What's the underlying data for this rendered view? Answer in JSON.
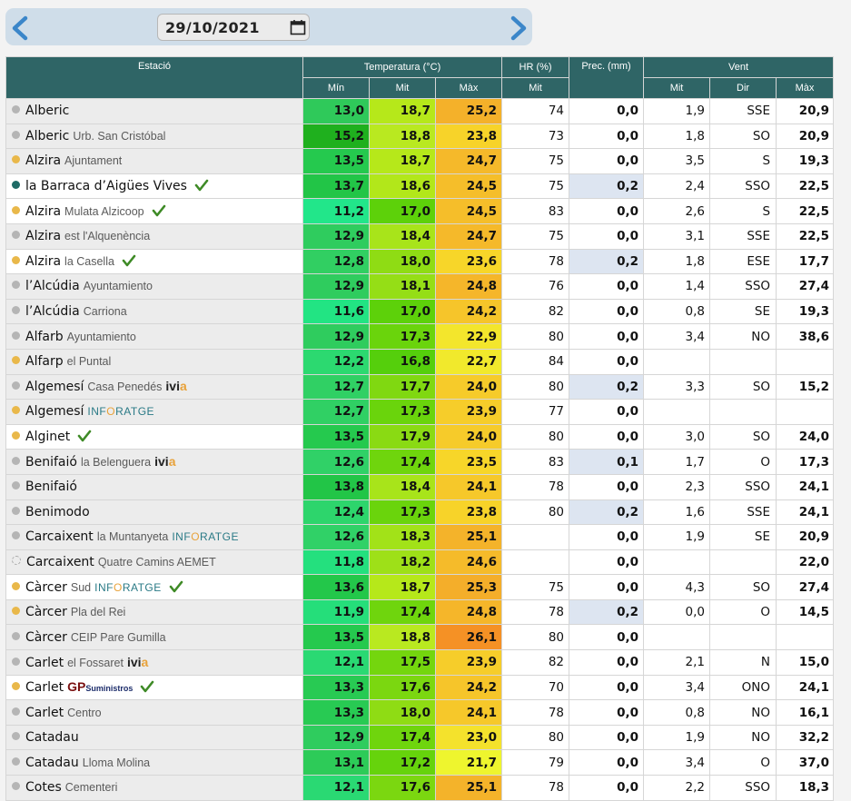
{
  "toolbar": {
    "date": "29/10/2021"
  },
  "headers": {
    "estacio": "Estació",
    "temperatura": "Temperatura (°C)",
    "hr": "HR (%)",
    "prec": "Prec. (mm)",
    "vent": "Vent",
    "min": "Mín",
    "mit": "Mit",
    "max": "Màx",
    "hr_mit": "Mit",
    "vent_mit": "Mit",
    "dir": "Dir",
    "vent_max": "Màx"
  },
  "colors": {
    "header_bg": "#2f6566",
    "dot_gray": "#b5b5b5",
    "dot_orange": "#e9b84a",
    "dot_teal": "#1f6b66",
    "precip_highlight": "#dde5f1",
    "check": "#3e8a26"
  },
  "rows": [
    {
      "name": "Alberic",
      "sub": "",
      "brand": "",
      "dot": "gray",
      "check": false,
      "active": false,
      "tmin": "13,0",
      "tmit": "18,7",
      "tmax": "25,2",
      "cmin": "#2fc95a",
      "cmit": "#b6e81a",
      "cmax": "#f4b12a",
      "hr": "74",
      "prec": "0,0",
      "prec_hl": false,
      "vmit": "1,9",
      "dir": "SSE",
      "vmax": "20,9"
    },
    {
      "name": "Alberic",
      "sub": "Urb. San Cristóbal",
      "brand": "",
      "dot": "gray",
      "check": false,
      "active": false,
      "tmin": "15,2",
      "tmit": "18,8",
      "tmax": "23,8",
      "cmin": "#1fb01e",
      "cmit": "#b9e920",
      "cmax": "#f7d329",
      "hr": "73",
      "prec": "0,0",
      "prec_hl": false,
      "vmit": "1,8",
      "dir": "SO",
      "vmax": "20,9"
    },
    {
      "name": "Alzira",
      "sub": "Ajuntament",
      "brand": "",
      "dot": "orange",
      "check": false,
      "active": false,
      "tmin": "13,5",
      "tmit": "18,7",
      "tmax": "24,7",
      "cmin": "#25c94e",
      "cmit": "#b6e81a",
      "cmax": "#f5b92a",
      "hr": "75",
      "prec": "0,0",
      "prec_hl": false,
      "vmit": "3,5",
      "dir": "S",
      "vmax": "19,3"
    },
    {
      "name": "la Barraca d’Aigües Vives",
      "sub": "",
      "brand": "",
      "dot": "teal",
      "check": true,
      "active": true,
      "tmin": "13,7",
      "tmit": "18,6",
      "tmax": "24,5",
      "cmin": "#22c547",
      "cmit": "#b2e71a",
      "cmax": "#f5be2a",
      "hr": "75",
      "prec": "0,2",
      "prec_hl": true,
      "vmit": "2,4",
      "dir": "SSO",
      "vmax": "22,5"
    },
    {
      "name": "Alzira",
      "sub": "Mulata Alzicoop",
      "brand": "",
      "dot": "orange",
      "check": true,
      "active": true,
      "tmin": "11,2",
      "tmit": "17,0",
      "tmax": "24,5",
      "cmin": "#22e68a",
      "cmit": "#5dd10a",
      "cmax": "#f5be2a",
      "hr": "83",
      "prec": "0,0",
      "prec_hl": false,
      "vmit": "2,6",
      "dir": "S",
      "vmax": "22,5"
    },
    {
      "name": "Alzira",
      "sub": "est l'Alquenència",
      "brand": "",
      "dot": "gray",
      "check": false,
      "active": false,
      "tmin": "12,9",
      "tmit": "18,4",
      "tmax": "24,7",
      "cmin": "#2fcc5e",
      "cmit": "#a8e41a",
      "cmax": "#f5b92a",
      "hr": "75",
      "prec": "0,0",
      "prec_hl": false,
      "vmit": "3,1",
      "dir": "SSE",
      "vmax": "22,5"
    },
    {
      "name": "Alzira",
      "sub": "la Casella",
      "brand": "",
      "dot": "orange",
      "check": true,
      "active": true,
      "tmin": "12,8",
      "tmit": "18,0",
      "tmax": "23,6",
      "cmin": "#31cf62",
      "cmit": "#8fdc14",
      "cmax": "#f7d629",
      "hr": "78",
      "prec": "0,2",
      "prec_hl": true,
      "vmit": "1,8",
      "dir": "ESE",
      "vmax": "17,7"
    },
    {
      "name": "l’Alcúdia",
      "sub": "Ayuntamiento",
      "brand": "",
      "dot": "gray",
      "check": false,
      "active": false,
      "tmin": "12,9",
      "tmit": "18,1",
      "tmax": "24,8",
      "cmin": "#2fcc5e",
      "cmit": "#95de16",
      "cmax": "#f5b62a",
      "hr": "76",
      "prec": "0,0",
      "prec_hl": false,
      "vmit": "1,4",
      "dir": "SSO",
      "vmax": "27,4"
    },
    {
      "name": "l’Alcúdia",
      "sub": "Carriona",
      "brand": "",
      "dot": "gray",
      "check": false,
      "active": false,
      "tmin": "11,6",
      "tmit": "17,0",
      "tmax": "24,2",
      "cmin": "#22e483",
      "cmit": "#5dd10a",
      "cmax": "#f6c52a",
      "hr": "82",
      "prec": "0,0",
      "prec_hl": false,
      "vmit": "0,8",
      "dir": "SE",
      "vmax": "19,3"
    },
    {
      "name": "Alfarb",
      "sub": "Ayuntamiento",
      "brand": "",
      "dot": "gray",
      "check": false,
      "active": false,
      "tmin": "12,9",
      "tmit": "17,3",
      "tmax": "22,9",
      "cmin": "#2fcc5e",
      "cmit": "#6ad40c",
      "cmax": "#f3e62c",
      "hr": "80",
      "prec": "0,0",
      "prec_hl": false,
      "vmit": "3,4",
      "dir": "NO",
      "vmax": "38,6"
    },
    {
      "name": "Alfarp",
      "sub": "el Puntal",
      "brand": "",
      "dot": "orange",
      "check": false,
      "active": false,
      "tmin": "12,2",
      "tmit": "16,8",
      "tmax": "22,7",
      "cmin": "#2cd970",
      "cmit": "#55cf0c",
      "cmax": "#f1e92c",
      "hr": "84",
      "prec": "0,0",
      "prec_hl": false,
      "vmit": "",
      "dir": "",
      "vmax": ""
    },
    {
      "name": "Algemesí",
      "sub": "Casa Penedés",
      "brand": "ivia",
      "dot": "gray",
      "check": false,
      "active": false,
      "tmin": "12,7",
      "tmit": "17,7",
      "tmax": "24,0",
      "cmin": "#30d064",
      "cmit": "#80d811",
      "cmax": "#f6cb2a",
      "hr": "80",
      "prec": "0,2",
      "prec_hl": true,
      "vmit": "3,3",
      "dir": "SO",
      "vmax": "15,2"
    },
    {
      "name": "Algemesí",
      "sub": "",
      "brand": "inforatge",
      "dot": "orange",
      "check": false,
      "active": false,
      "tmin": "12,7",
      "tmit": "17,3",
      "tmax": "23,9",
      "cmin": "#30d064",
      "cmit": "#6ad40c",
      "cmax": "#f6cd2a",
      "hr": "77",
      "prec": "0,0",
      "prec_hl": false,
      "vmit": "",
      "dir": "",
      "vmax": ""
    },
    {
      "name": "Alginet",
      "sub": "",
      "brand": "",
      "dot": "orange",
      "check": true,
      "active": true,
      "tmin": "13,5",
      "tmit": "17,9",
      "tmax": "24,0",
      "cmin": "#25c94e",
      "cmit": "#8ada13",
      "cmax": "#f6cb2a",
      "hr": "80",
      "prec": "0,0",
      "prec_hl": false,
      "vmit": "3,0",
      "dir": "SO",
      "vmax": "24,0"
    },
    {
      "name": "Benifaió",
      "sub": "la Belenguera",
      "brand": "ivia",
      "dot": "gray",
      "check": false,
      "active": false,
      "tmin": "12,6",
      "tmit": "17,4",
      "tmax": "23,5",
      "cmin": "#30d167",
      "cmit": "#6fd50d",
      "cmax": "#f7d629",
      "hr": "83",
      "prec": "0,1",
      "prec_hl": true,
      "vmit": "1,7",
      "dir": "O",
      "vmax": "17,3"
    },
    {
      "name": "Benifaió",
      "sub": "",
      "brand": "",
      "dot": "gray",
      "check": false,
      "active": false,
      "tmin": "13,8",
      "tmit": "18,4",
      "tmax": "24,1",
      "cmin": "#22c547",
      "cmit": "#a8e41a",
      "cmax": "#f6c82a",
      "hr": "78",
      "prec": "0,0",
      "prec_hl": false,
      "vmit": "2,3",
      "dir": "SSO",
      "vmax": "24,1"
    },
    {
      "name": "Benimodo",
      "sub": "",
      "brand": "",
      "dot": "gray",
      "check": false,
      "active": false,
      "tmin": "12,4",
      "tmit": "17,3",
      "tmax": "23,8",
      "cmin": "#2dd56c",
      "cmit": "#6ad40c",
      "cmax": "#f7d329",
      "hr": "80",
      "prec": "0,2",
      "prec_hl": true,
      "vmit": "1,6",
      "dir": "SSE",
      "vmax": "24,1"
    },
    {
      "name": "Carcaixent",
      "sub": "la Muntanyeta",
      "brand": "inforatge",
      "dot": "gray",
      "check": false,
      "active": false,
      "tmin": "12,6",
      "tmit": "18,3",
      "tmax": "25,1",
      "cmin": "#30d167",
      "cmit": "#a2e218",
      "cmax": "#f4b32a",
      "hr": "",
      "prec": "0,0",
      "prec_hl": false,
      "vmit": "1,9",
      "dir": "SE",
      "vmax": "20,9"
    },
    {
      "name": "Carcaixent",
      "sub": "Quatre Camins AEMET",
      "brand": "",
      "dot": "dashed",
      "check": false,
      "active": false,
      "tmin": "11,8",
      "tmit": "18,2",
      "tmax": "24,6",
      "cmin": "#24e07e",
      "cmit": "#9ee018",
      "cmax": "#f5bb2a",
      "hr": "",
      "prec": "0,0",
      "prec_hl": false,
      "vmit": "",
      "dir": "",
      "vmax": "22,0"
    },
    {
      "name": "Càrcer",
      "sub": "Sud",
      "brand": "inforatge",
      "dot": "orange",
      "check": true,
      "active": true,
      "tmin": "13,6",
      "tmit": "18,7",
      "tmax": "25,3",
      "cmin": "#23c74a",
      "cmit": "#b6e81a",
      "cmax": "#f4ae2a",
      "hr": "75",
      "prec": "0,0",
      "prec_hl": false,
      "vmit": "4,3",
      "dir": "SO",
      "vmax": "27,4"
    },
    {
      "name": "Càrcer",
      "sub": "Pla del Rei",
      "brand": "",
      "dot": "orange",
      "check": false,
      "active": false,
      "tmin": "11,9",
      "tmit": "17,4",
      "tmax": "24,8",
      "cmin": "#25de7a",
      "cmit": "#6fd50d",
      "cmax": "#f5b62a",
      "hr": "78",
      "prec": "0,2",
      "prec_hl": true,
      "vmit": "0,0",
      "dir": "O",
      "vmax": "14,5"
    },
    {
      "name": "Càrcer",
      "sub": "CEIP Pare Gumilla",
      "brand": "",
      "dot": "gray",
      "check": false,
      "active": false,
      "tmin": "13,5",
      "tmit": "18,8",
      "tmax": "26,1",
      "cmin": "#25c94e",
      "cmit": "#b9e920",
      "cmax": "#f59125",
      "hr": "80",
      "prec": "0,0",
      "prec_hl": false,
      "vmit": "",
      "dir": "",
      "vmax": ""
    },
    {
      "name": "Carlet",
      "sub": "el Fossaret",
      "brand": "ivia",
      "dot": "gray",
      "check": false,
      "active": false,
      "tmin": "12,1",
      "tmit": "17,5",
      "tmax": "23,9",
      "cmin": "#2ad973",
      "cmit": "#74d60e",
      "cmax": "#f6cd2a",
      "hr": "82",
      "prec": "0,0",
      "prec_hl": false,
      "vmit": "2,1",
      "dir": "N",
      "vmax": "15,0"
    },
    {
      "name": "Carlet",
      "sub": "",
      "brand": "gp",
      "dot": "orange",
      "check": true,
      "active": true,
      "tmin": "13,3",
      "tmit": "17,6",
      "tmax": "24,2",
      "cmin": "#28ca53",
      "cmit": "#7bd710",
      "cmax": "#f6c52a",
      "hr": "70",
      "prec": "0,0",
      "prec_hl": false,
      "vmit": "3,4",
      "dir": "ONO",
      "vmax": "24,1"
    },
    {
      "name": "Carlet",
      "sub": "Centro",
      "brand": "",
      "dot": "gray",
      "check": false,
      "active": false,
      "tmin": "13,3",
      "tmit": "18,0",
      "tmax": "24,1",
      "cmin": "#28ca53",
      "cmit": "#8fdc14",
      "cmax": "#f6c82a",
      "hr": "78",
      "prec": "0,0",
      "prec_hl": false,
      "vmit": "0,8",
      "dir": "NO",
      "vmax": "16,1"
    },
    {
      "name": "Catadau",
      "sub": "",
      "brand": "",
      "dot": "gray",
      "check": false,
      "active": false,
      "tmin": "12,9",
      "tmit": "17,4",
      "tmax": "23,0",
      "cmin": "#2fcc5e",
      "cmit": "#6fd50d",
      "cmax": "#f4e22c",
      "hr": "80",
      "prec": "0,0",
      "prec_hl": false,
      "vmit": "1,9",
      "dir": "NO",
      "vmax": "32,2"
    },
    {
      "name": "Catadau",
      "sub": "Lloma Molina",
      "brand": "",
      "dot": "gray",
      "check": false,
      "active": false,
      "tmin": "13,1",
      "tmit": "17,2",
      "tmax": "21,7",
      "cmin": "#2dcb58",
      "cmit": "#66d30c",
      "cmax": "#eef52e",
      "hr": "79",
      "prec": "0,0",
      "prec_hl": false,
      "vmit": "3,4",
      "dir": "O",
      "vmax": "37,0"
    },
    {
      "name": "Cotes",
      "sub": "Cementeri",
      "brand": "",
      "dot": "gray",
      "check": false,
      "active": false,
      "tmin": "12,1",
      "tmit": "17,6",
      "tmax": "25,1",
      "cmin": "#2ad973",
      "cmit": "#7bd710",
      "cmax": "#f4b32a",
      "hr": "78",
      "prec": "0,0",
      "prec_hl": false,
      "vmit": "2,2",
      "dir": "SSO",
      "vmax": "18,3"
    }
  ]
}
